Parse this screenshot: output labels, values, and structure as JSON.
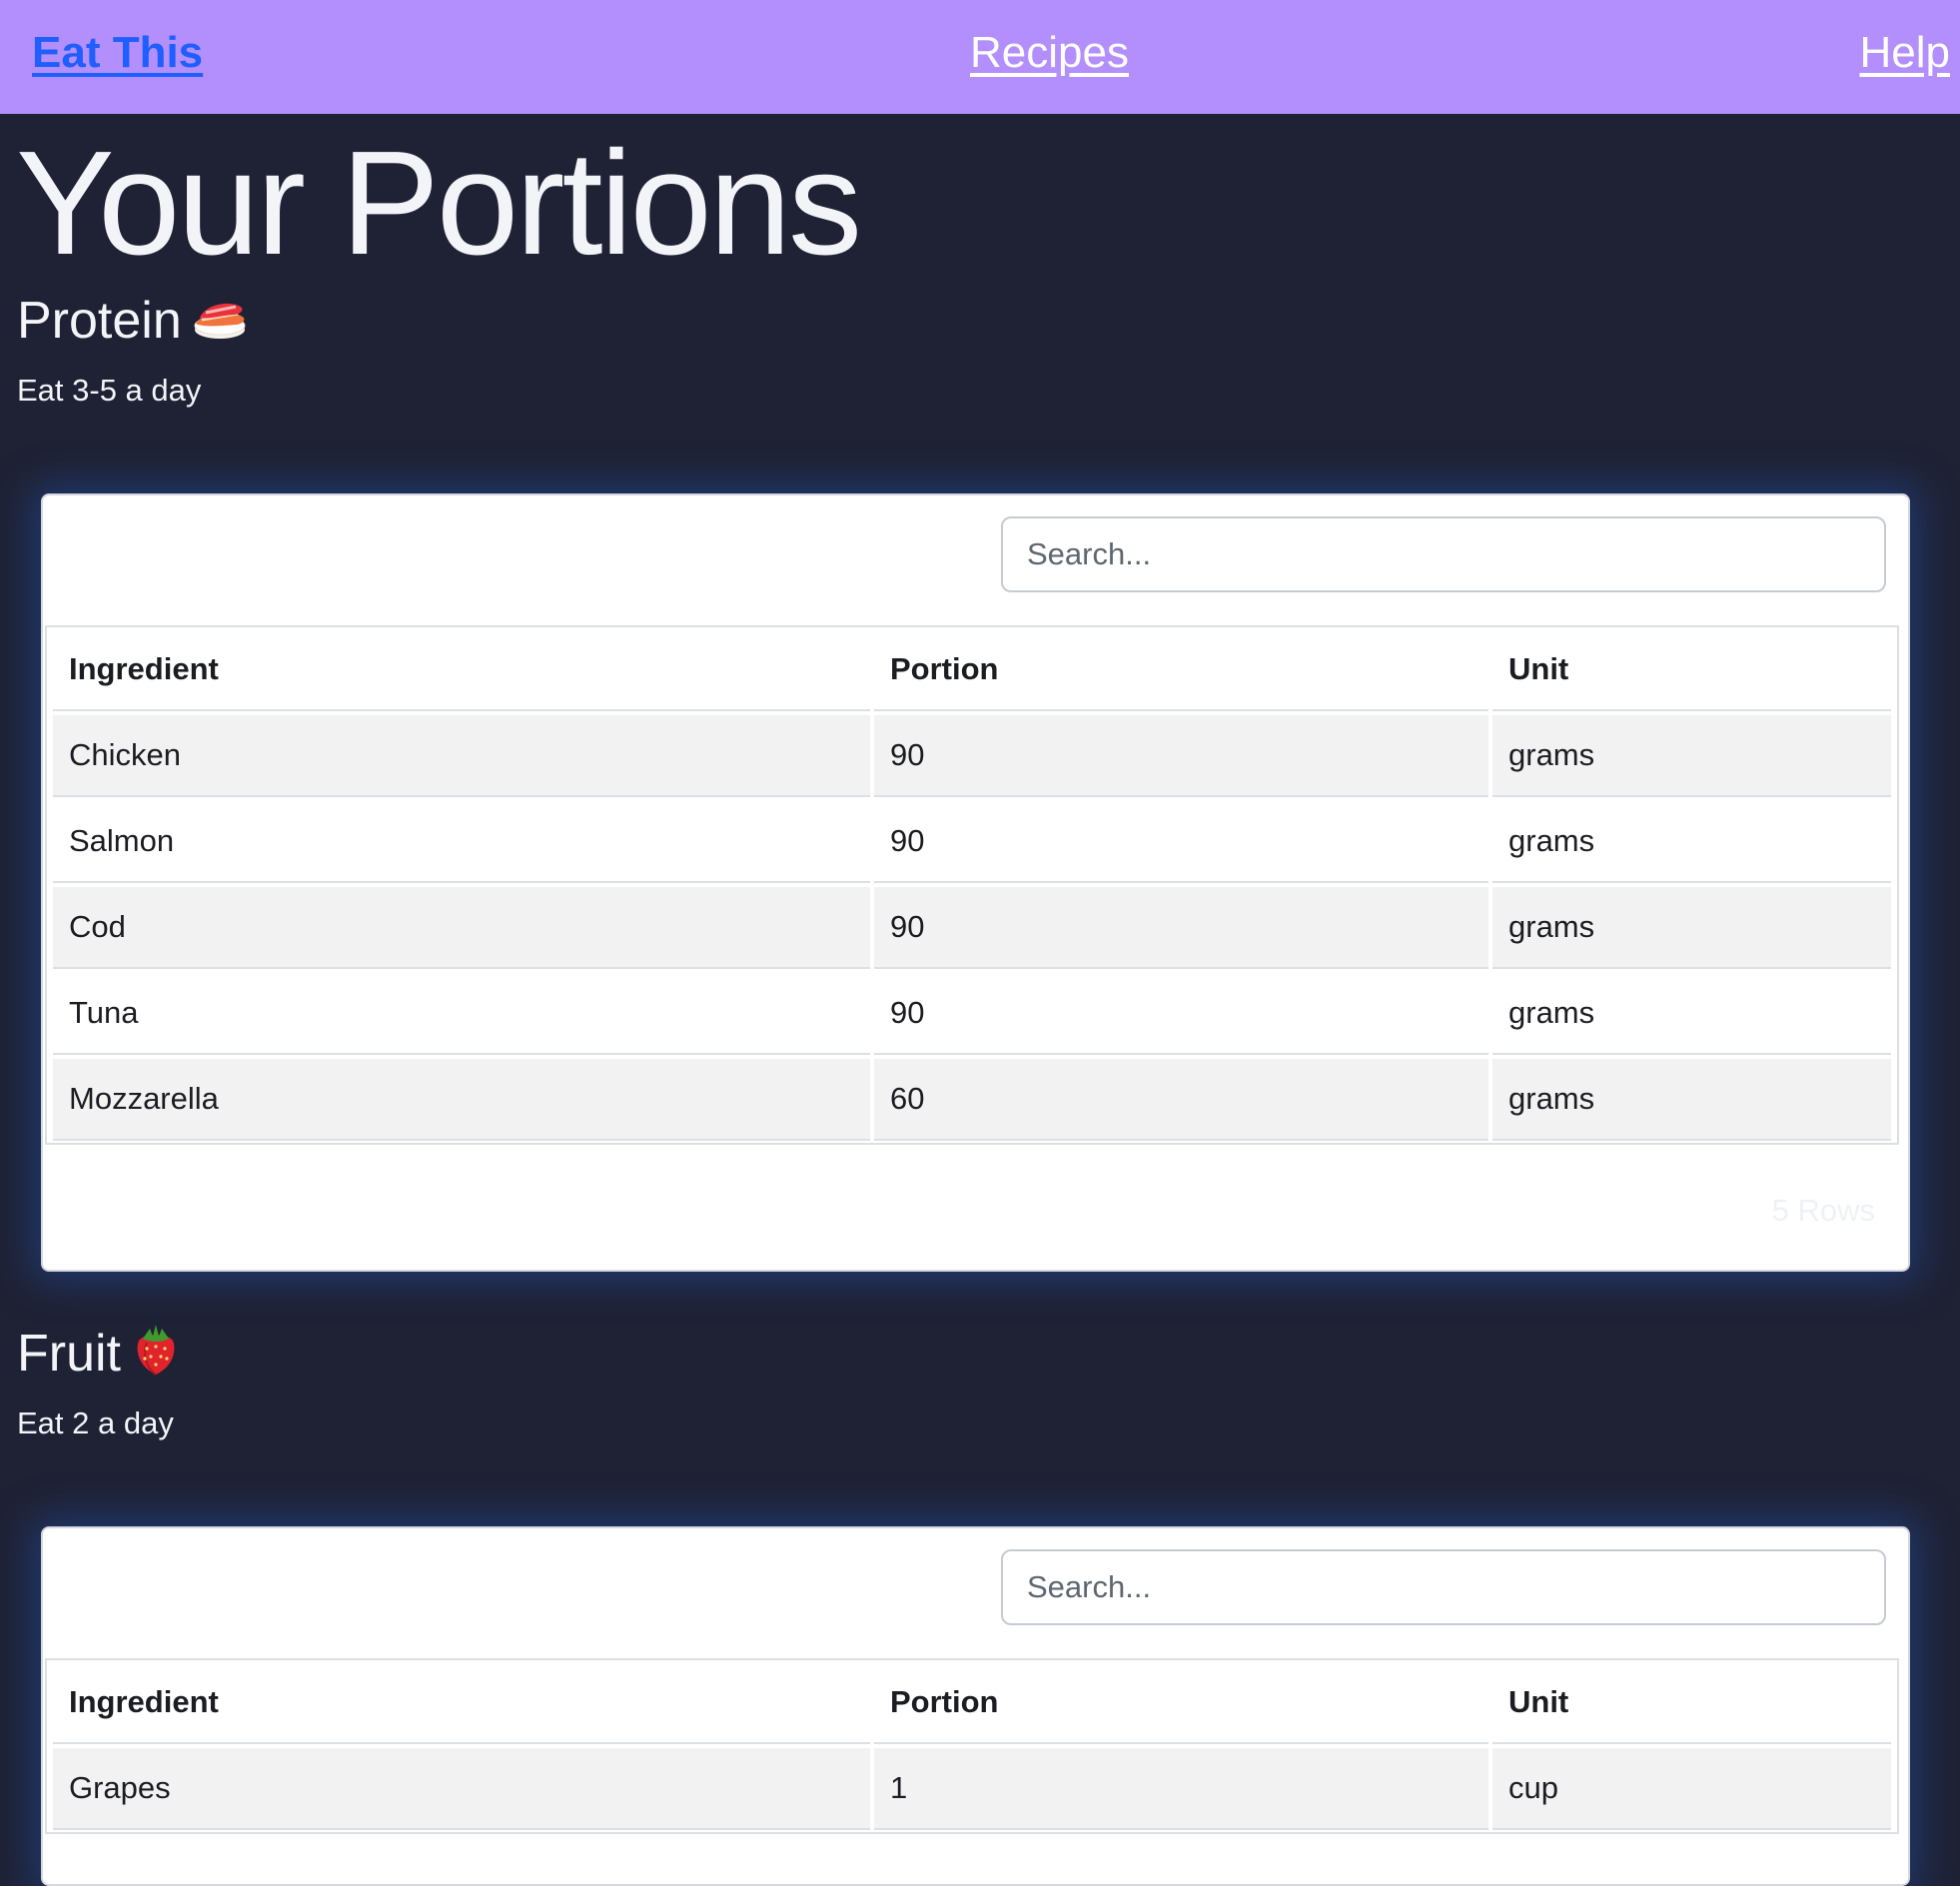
{
  "navbar": {
    "brand": "Eat This",
    "links": [
      "Recipes",
      "Help"
    ]
  },
  "page": {
    "title": "Your Portions"
  },
  "sections": [
    {
      "heading": "Protein",
      "icon": "sushi-icon",
      "note": "Eat 3-5 a day",
      "search_placeholder": "Search...",
      "columns": [
        "Ingredient",
        "Portion",
        "Unit"
      ],
      "rows": [
        [
          "Chicken",
          "90",
          "grams"
        ],
        [
          "Salmon",
          "90",
          "grams"
        ],
        [
          "Cod",
          "90",
          "grams"
        ],
        [
          "Tuna",
          "90",
          "grams"
        ],
        [
          "Mozzarella",
          "60",
          "grams"
        ]
      ],
      "row_count": "5 Rows"
    },
    {
      "heading": "Fruit",
      "icon": "strawberry-icon",
      "note": "Eat 2 a day",
      "search_placeholder": "Search...",
      "columns": [
        "Ingredient",
        "Portion",
        "Unit"
      ],
      "rows": [
        [
          "Grapes",
          "1",
          "cup"
        ]
      ]
    }
  ],
  "colors": {
    "navbar": "#b38ffd",
    "brand_link": "#1f5eff",
    "background": "#1f2235",
    "striped_row": "#f2f2f2"
  }
}
